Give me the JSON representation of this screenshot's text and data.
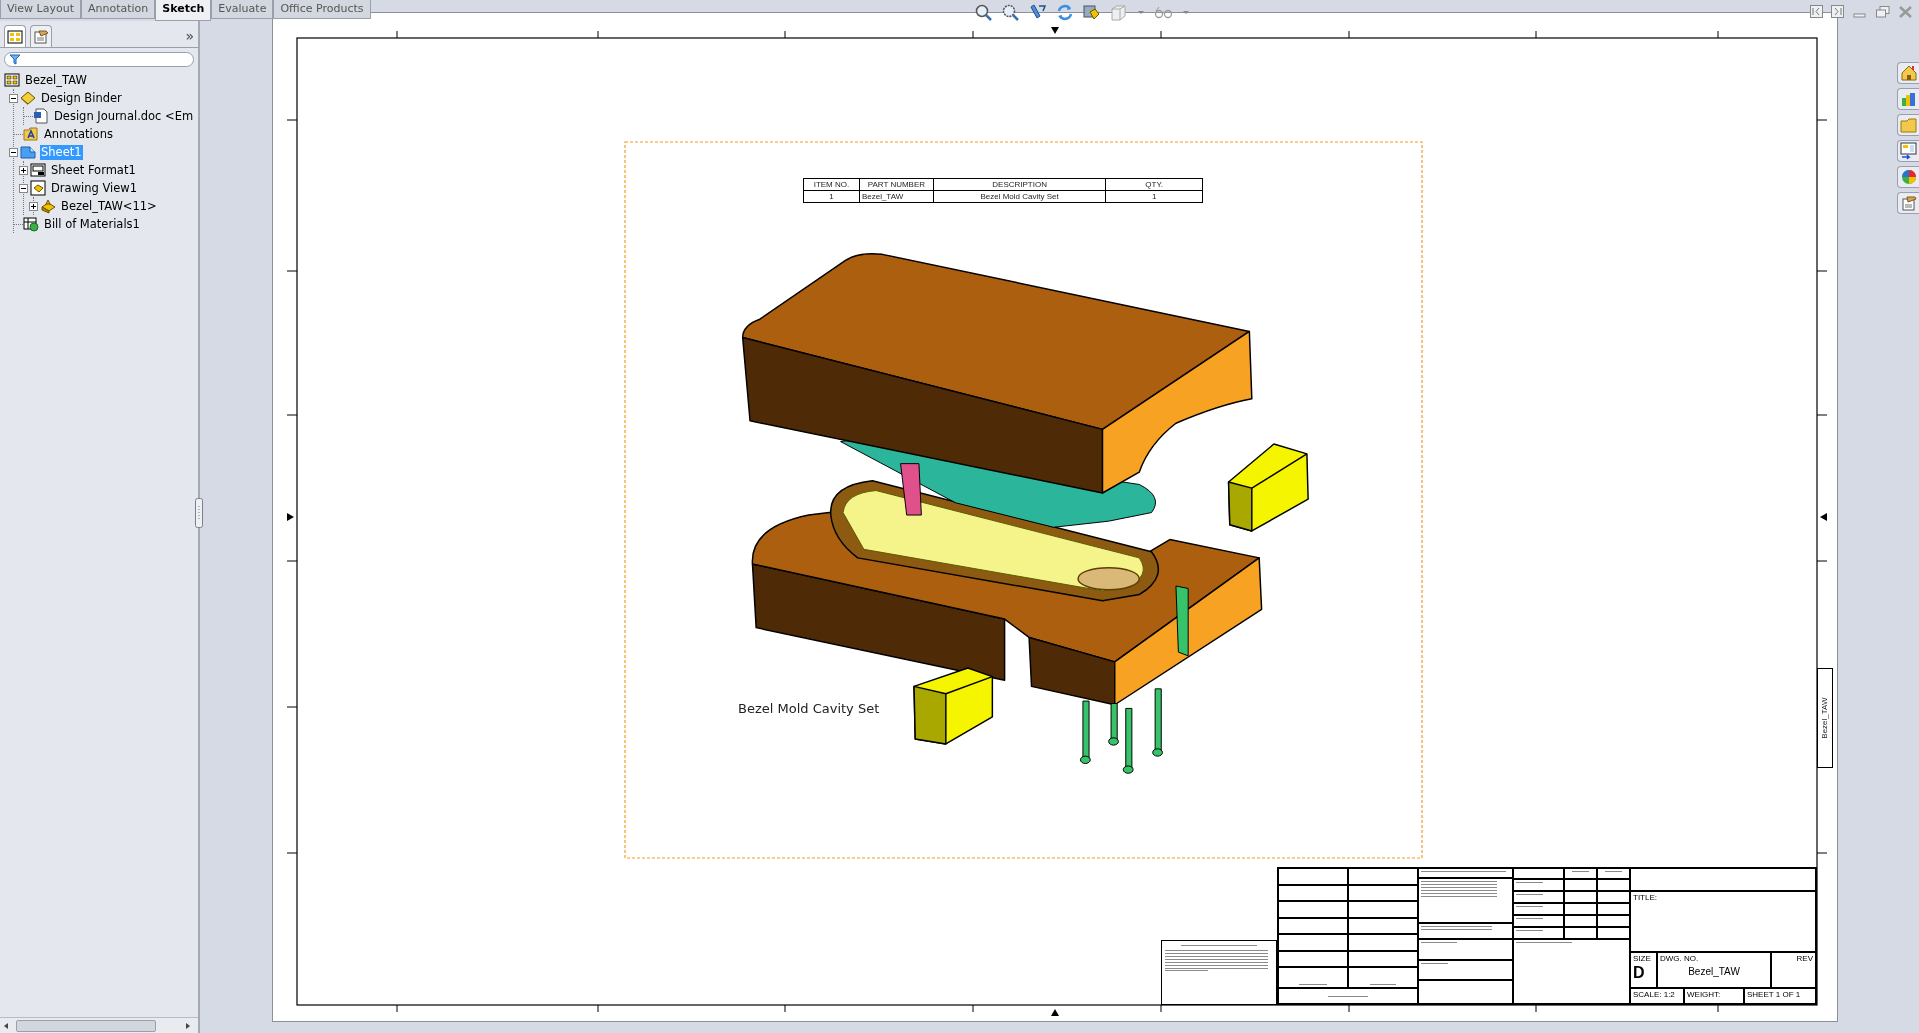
{
  "tabs": [
    {
      "label": "View Layout",
      "selected": false
    },
    {
      "label": "Annotation",
      "selected": false
    },
    {
      "label": "Sketch",
      "selected": true
    },
    {
      "label": "Evaluate",
      "selected": false
    },
    {
      "label": "Office Products",
      "selected": false
    }
  ],
  "panel": {
    "expand_glyph": "»"
  },
  "tree": [
    {
      "label": "Bezel_TAW",
      "kind": "drawing",
      "selected": false,
      "children": [
        {
          "label": "Design Binder",
          "kind": "binder",
          "expanded": true,
          "selected": false,
          "children": [
            {
              "label": "Design Journal.doc <Em",
              "kind": "document",
              "selected": false
            }
          ]
        },
        {
          "label": "Annotations",
          "kind": "annotations",
          "selected": false
        },
        {
          "label": "Sheet1",
          "kind": "sheet",
          "expanded": true,
          "selected": true,
          "children": [
            {
              "label": "Sheet Format1",
              "kind": "sheet-format",
              "expanded": false,
              "selected": false
            },
            {
              "label": "Drawing View1",
              "kind": "view",
              "expanded": true,
              "selected": false,
              "children": [
                {
                  "label": "Bezel_TAW<11>",
                  "kind": "part",
                  "expanded": false,
                  "selected": false
                }
              ]
            }
          ]
        },
        {
          "label": "Bill of Materials1",
          "kind": "bom",
          "selected": false
        }
      ]
    }
  ],
  "sheet": {
    "bom": {
      "columns": [
        "ITEM NO.",
        "PART NUMBER",
        "DESCRIPTION",
        "QTY."
      ],
      "rows": [
        [
          "1",
          "Bezel_TAW",
          "Bezel Mold Cavity Set",
          "1"
        ]
      ]
    },
    "view_label": "Bezel Mold Cavity Set",
    "edge_label": "Bezel_TAW",
    "title_block": {
      "title_label": "TITLE:",
      "size_label": "SIZE",
      "size": "D",
      "dwg_no_label": "DWG. NO.",
      "dwg_no": "Bezel_TAW",
      "rev_label": "REV",
      "scale": "SCALE: 1:2",
      "weight_label": "WEIGHT:",
      "sheet_no": "SHEET 1 OF 1"
    }
  }
}
